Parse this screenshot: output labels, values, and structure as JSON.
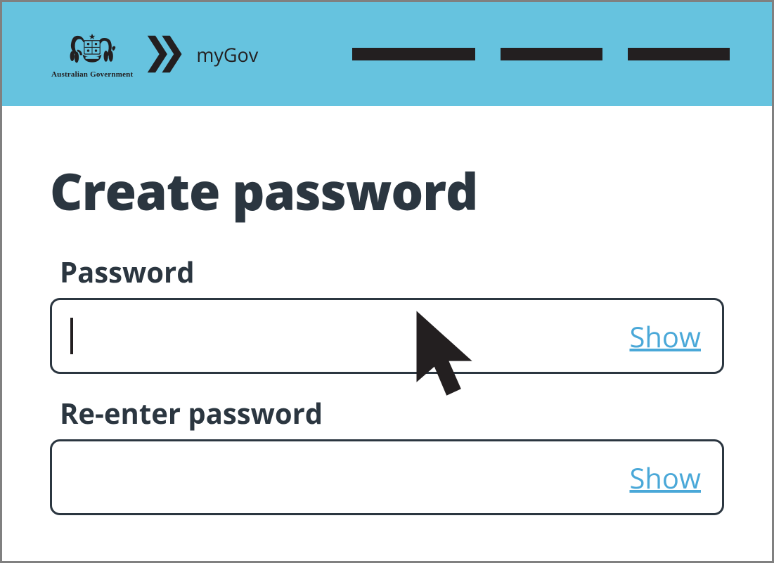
{
  "header": {
    "gov_label": "Australian Government",
    "brand_text": "myGov"
  },
  "page": {
    "title": "Create password"
  },
  "fields": {
    "password": {
      "label": "Password",
      "value": "",
      "show_label": "Show"
    },
    "reenter": {
      "label": "Re-enter password",
      "value": "",
      "show_label": "Show"
    }
  }
}
